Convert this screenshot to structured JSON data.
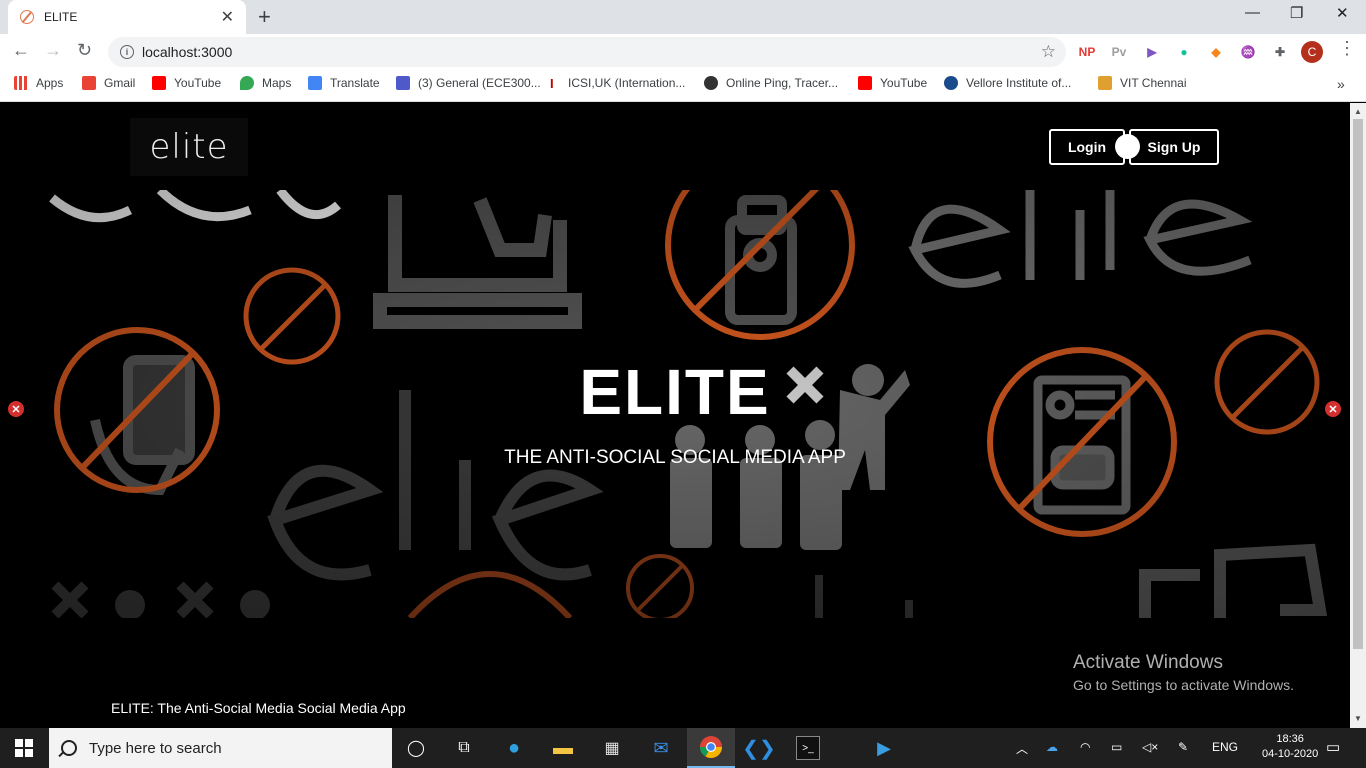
{
  "browser": {
    "tab_title": "ELITE",
    "url": "localhost:3000",
    "bookmarks": [
      {
        "label": "Apps",
        "icon": "apps-grid-icon",
        "color": "#4285f4"
      },
      {
        "label": "Gmail",
        "icon": "gmail-icon",
        "color": "#ea4335"
      },
      {
        "label": "YouTube",
        "icon": "youtube-icon",
        "color": "#ff0000"
      },
      {
        "label": "Maps",
        "icon": "maps-pin-icon",
        "color": "#34a853"
      },
      {
        "label": "Translate",
        "icon": "translate-icon",
        "color": "#4285f4"
      },
      {
        "label": "(3) General (ECE300...",
        "icon": "teams-icon",
        "color": "#5059c9"
      },
      {
        "label": "ICSI,UK (Internation...",
        "icon": "icsi-icon",
        "color": "#c00000"
      },
      {
        "label": "Online Ping, Tracer...",
        "icon": "penguin-icon",
        "color": "#333333"
      },
      {
        "label": "YouTube",
        "icon": "youtube-icon",
        "color": "#ff0000"
      },
      {
        "label": "Vellore Institute of...",
        "icon": "vit-icon",
        "color": "#1a4b8c"
      },
      {
        "label": "VIT Chennai",
        "icon": "vit-chennai-icon",
        "color": "#e0a030"
      }
    ],
    "extensions": [
      "NP",
      "Pv"
    ],
    "profile_initial": "C"
  },
  "site": {
    "logo": "elite",
    "login_label": "Login",
    "signup_label": "Sign Up",
    "hero_title": "ELITE",
    "hero_subtitle": "THE ANTI-SOCIAL SOCIAL MEDIA APP",
    "footer_text": "ELITE: The Anti-Social Media Social Media App",
    "accent_color": "#d2581f"
  },
  "watermark": {
    "title": "Activate Windows",
    "subtitle": "Go to Settings to activate Windows."
  },
  "taskbar": {
    "search_placeholder": "Type here to search",
    "language": "ENG",
    "time": "18:36",
    "date": "04-10-2020"
  }
}
